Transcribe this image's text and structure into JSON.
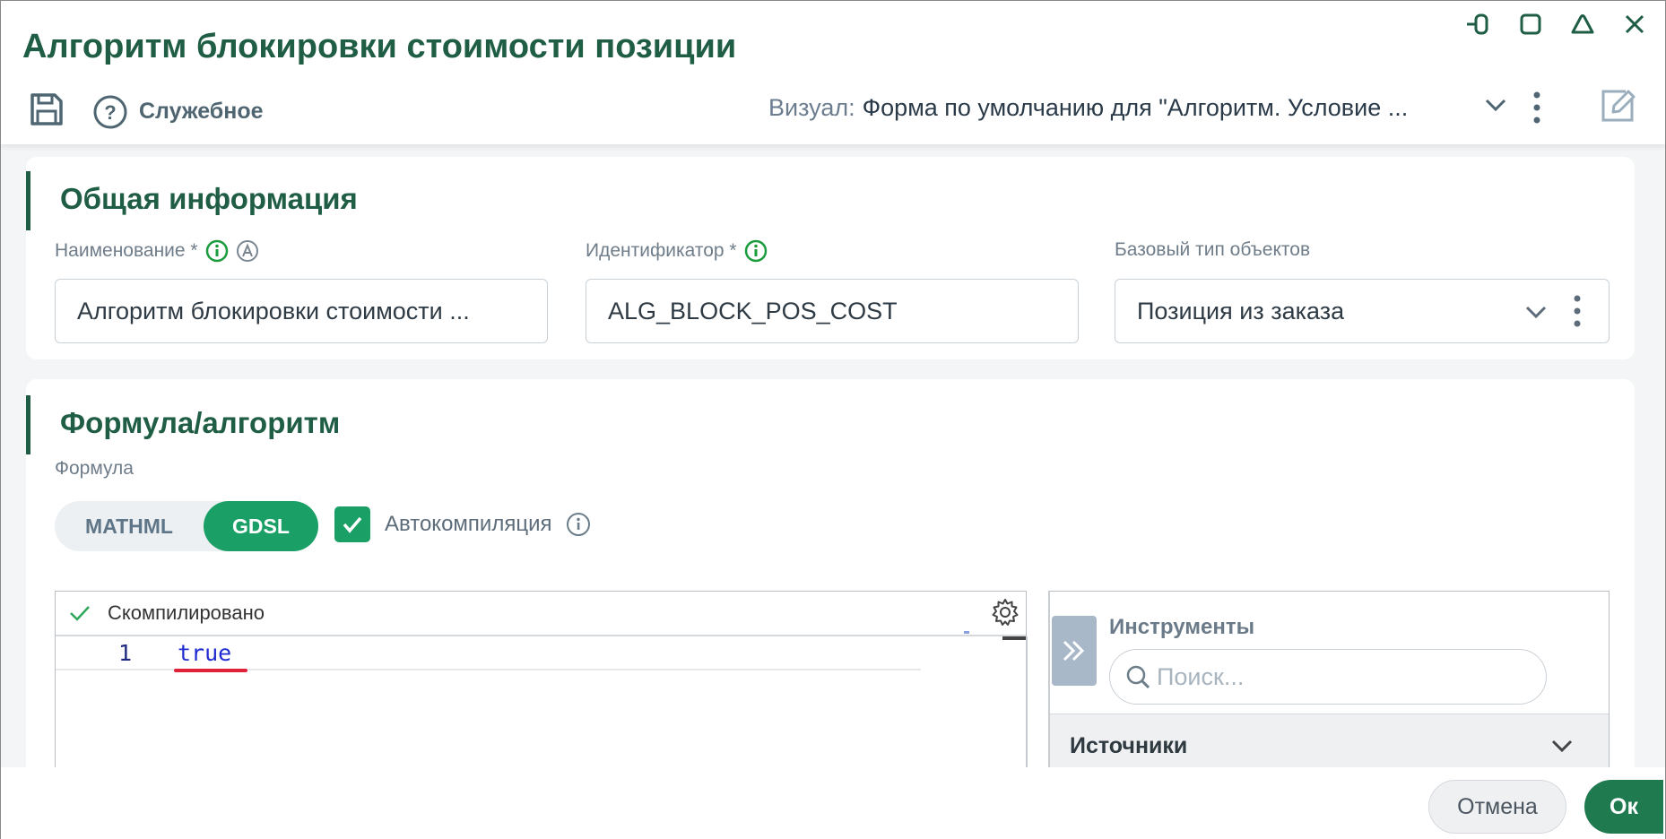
{
  "dialog": {
    "title": "Алгоритм блокировки стоимости позиции",
    "window_controls": [
      "pin-icon",
      "maximize-icon",
      "collapse-icon",
      "close-icon"
    ]
  },
  "toolbar": {
    "save_icon": "save-icon",
    "service_label": "Служебное",
    "visual_label": "Визуал:",
    "visual_value": "Форма по умолчанию для \"Алгоритм. Условие ..."
  },
  "general": {
    "section_title": "Общая информация",
    "name": {
      "label": "Наименование *",
      "value": "Алгоритм блокировки стоимости ..."
    },
    "identifier": {
      "label": "Идентификатор *",
      "value": "ALG_BLOCK_POS_COST"
    },
    "base_type": {
      "label": "Базовый тип объектов",
      "value": "Позиция из заказа"
    }
  },
  "formula": {
    "section_title": "Формула/алгоритм",
    "formula_label": "Формула",
    "modes": [
      "MATHML",
      "GDSL"
    ],
    "active_mode": "GDSL",
    "autocompile_label": "Автокомпиляция",
    "autocompile_checked": true,
    "editor": {
      "status": "Скомпилировано",
      "lines": [
        {
          "number": "1",
          "code": "true"
        }
      ]
    },
    "tools": {
      "title": "Инструменты",
      "search_placeholder": "Поиск...",
      "sources_label": "Источники"
    }
  },
  "footer": {
    "cancel_label": "Отмена",
    "ok_label": "Ок"
  },
  "colors": {
    "brand_dark": "#1f5e45",
    "accent_green": "#1aa066",
    "ok_button": "#1f7a4f",
    "code_keyword": "#1f2bd0",
    "error_underline": "#e0213a"
  }
}
